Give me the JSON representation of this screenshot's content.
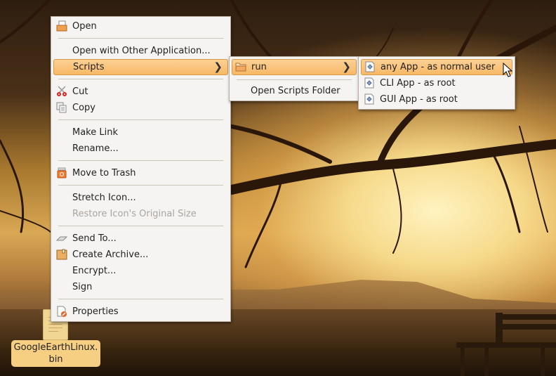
{
  "desktop": {
    "file_icon": {
      "name_line1": "GoogleEarthLinux.",
      "name_line2": "bin",
      "icon": "text-file-icon"
    }
  },
  "context_menu": {
    "items": [
      {
        "label": "Open",
        "icon": "open-document-icon"
      },
      {
        "label": "Open with Other Application...",
        "icon": null
      },
      {
        "label": "Scripts",
        "icon": null,
        "submenu": true,
        "highlighted": true
      },
      {
        "label": "Cut",
        "icon": "scissors-icon"
      },
      {
        "label": "Copy",
        "icon": "copy-icon"
      },
      {
        "label": "Make Link",
        "icon": null
      },
      {
        "label": "Rename...",
        "icon": null
      },
      {
        "label": "Move to Trash",
        "icon": "trash-icon"
      },
      {
        "label": "Stretch Icon...",
        "icon": null
      },
      {
        "label": "Restore Icon's Original Size",
        "icon": null,
        "disabled": true
      },
      {
        "label": "Send To...",
        "icon": "send-icon"
      },
      {
        "label": "Create Archive...",
        "icon": "archive-icon"
      },
      {
        "label": "Encrypt...",
        "icon": null
      },
      {
        "label": "Sign",
        "icon": null
      },
      {
        "label": "Properties",
        "icon": "properties-icon"
      }
    ]
  },
  "scripts_submenu": {
    "items": [
      {
        "label": "run",
        "icon": "folder-icon",
        "submenu": true,
        "highlighted": true
      },
      {
        "label": "Open Scripts Folder",
        "icon": null
      }
    ]
  },
  "run_submenu": {
    "items": [
      {
        "label": "any App - as normal user",
        "icon": "script-icon",
        "highlighted": true
      },
      {
        "label": "CLI App - as root",
        "icon": "script-icon"
      },
      {
        "label": "GUI App - as root",
        "icon": "script-icon"
      }
    ]
  },
  "colors": {
    "highlight": "#f7b865",
    "menu_bg": "#f5f4f2",
    "label_bg": "#f7cf83"
  }
}
